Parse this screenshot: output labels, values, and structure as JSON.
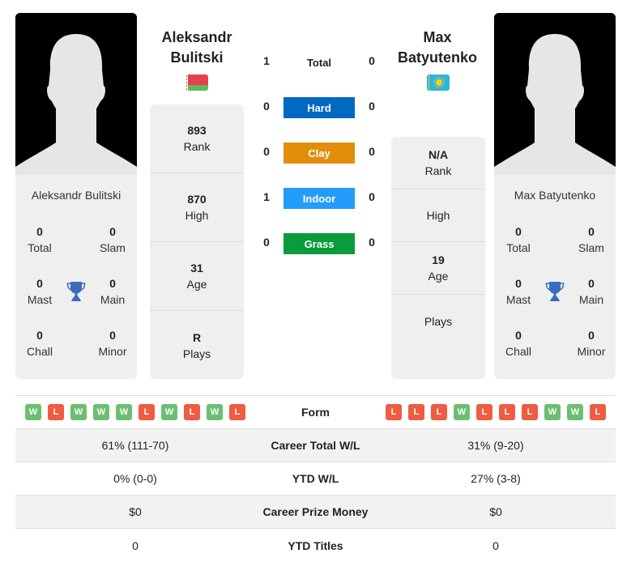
{
  "colors": {
    "hard": "#0069c2",
    "clay": "#e08e0b",
    "indoor": "#239dfa",
    "grass": "#0a9b3c",
    "win": "#6cbf72",
    "loss": "#ee5c42",
    "trophy": "#3a6ebd"
  },
  "player1": {
    "name_line1": "Aleksandr",
    "name_line2": "Bulitski",
    "full_name": "Aleksandr Bulitski",
    "flag": "belarus-flag",
    "titles": {
      "total": "0",
      "total_label": "Total",
      "slam": "0",
      "slam_label": "Slam",
      "mast": "0",
      "mast_label": "Mast",
      "main": "0",
      "main_label": "Main",
      "chall": "0",
      "chall_label": "Chall",
      "minor": "0",
      "minor_label": "Minor"
    },
    "stats": [
      {
        "value": "893",
        "label": "Rank"
      },
      {
        "value": "870",
        "label": "High"
      },
      {
        "value": "31",
        "label": "Age"
      },
      {
        "value": "R",
        "label": "Plays"
      }
    ],
    "form": [
      "W",
      "L",
      "W",
      "W",
      "W",
      "L",
      "W",
      "L",
      "W",
      "L"
    ],
    "career_wl": "61% (111-70)",
    "ytd_wl": "0% (0-0)",
    "prize": "$0",
    "ytd_titles": "0"
  },
  "player2": {
    "name_line1": "Max",
    "name_line2": "Batyutenko",
    "full_name": "Max Batyutenko",
    "flag": "kazakhstan-flag",
    "titles": {
      "total": "0",
      "total_label": "Total",
      "slam": "0",
      "slam_label": "Slam",
      "mast": "0",
      "mast_label": "Mast",
      "main": "0",
      "main_label": "Main",
      "chall": "0",
      "chall_label": "Chall",
      "minor": "0",
      "minor_label": "Minor"
    },
    "stats": [
      {
        "value": "N/A",
        "label": "Rank"
      },
      {
        "value": "",
        "label": "High"
      },
      {
        "value": "19",
        "label": "Age"
      },
      {
        "value": "",
        "label": "Plays"
      }
    ],
    "form": [
      "L",
      "L",
      "L",
      "W",
      "L",
      "L",
      "L",
      "W",
      "W",
      "L"
    ],
    "career_wl": "31% (9-20)",
    "ytd_wl": "27% (3-8)",
    "prize": "$0",
    "ytd_titles": "0"
  },
  "h2h": [
    {
      "label": "Total",
      "left": "1",
      "right": "0",
      "key": "total"
    },
    {
      "label": "Hard",
      "left": "0",
      "right": "0",
      "key": "hard"
    },
    {
      "label": "Clay",
      "left": "0",
      "right": "0",
      "key": "clay"
    },
    {
      "label": "Indoor",
      "left": "1",
      "right": "0",
      "key": "indoor"
    },
    {
      "label": "Grass",
      "left": "0",
      "right": "0",
      "key": "grass"
    }
  ],
  "table_labels": {
    "form": "Form",
    "career_wl": "Career Total W/L",
    "ytd_wl": "YTD W/L",
    "prize": "Career Prize Money",
    "ytd_titles": "YTD Titles"
  }
}
